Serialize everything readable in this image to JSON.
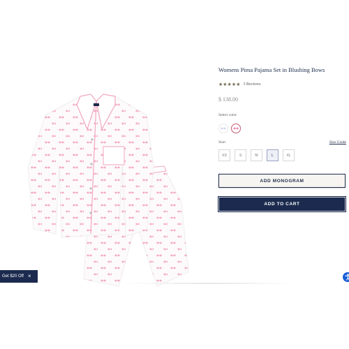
{
  "product": {
    "title": "Womens Pima Pajama Set in Blushing Bows",
    "stars": "★★★★★",
    "reviews": "3 Reviews",
    "price": "$ 138.00",
    "color_label": "Select color",
    "size_label": "Size:",
    "size_guide": "Size Guide",
    "sizes": [
      "XS",
      "S",
      "M",
      "L",
      "XL"
    ],
    "selected_size": "L",
    "monogram_label": "ADD MONOGRAM",
    "cart_label": "ADD TO CART"
  },
  "promo": {
    "label": "Get $20 Off",
    "close": "×"
  },
  "colors": {
    "navy": "#1b2a4e",
    "pink": "#e88bab",
    "gold": "#756a4e",
    "accessibility": "#1b5fd6"
  },
  "icons": [
    "pajama-product-image",
    "swatch-light-icon",
    "swatch-pink-icon",
    "close-icon",
    "accessibility-icon"
  ]
}
